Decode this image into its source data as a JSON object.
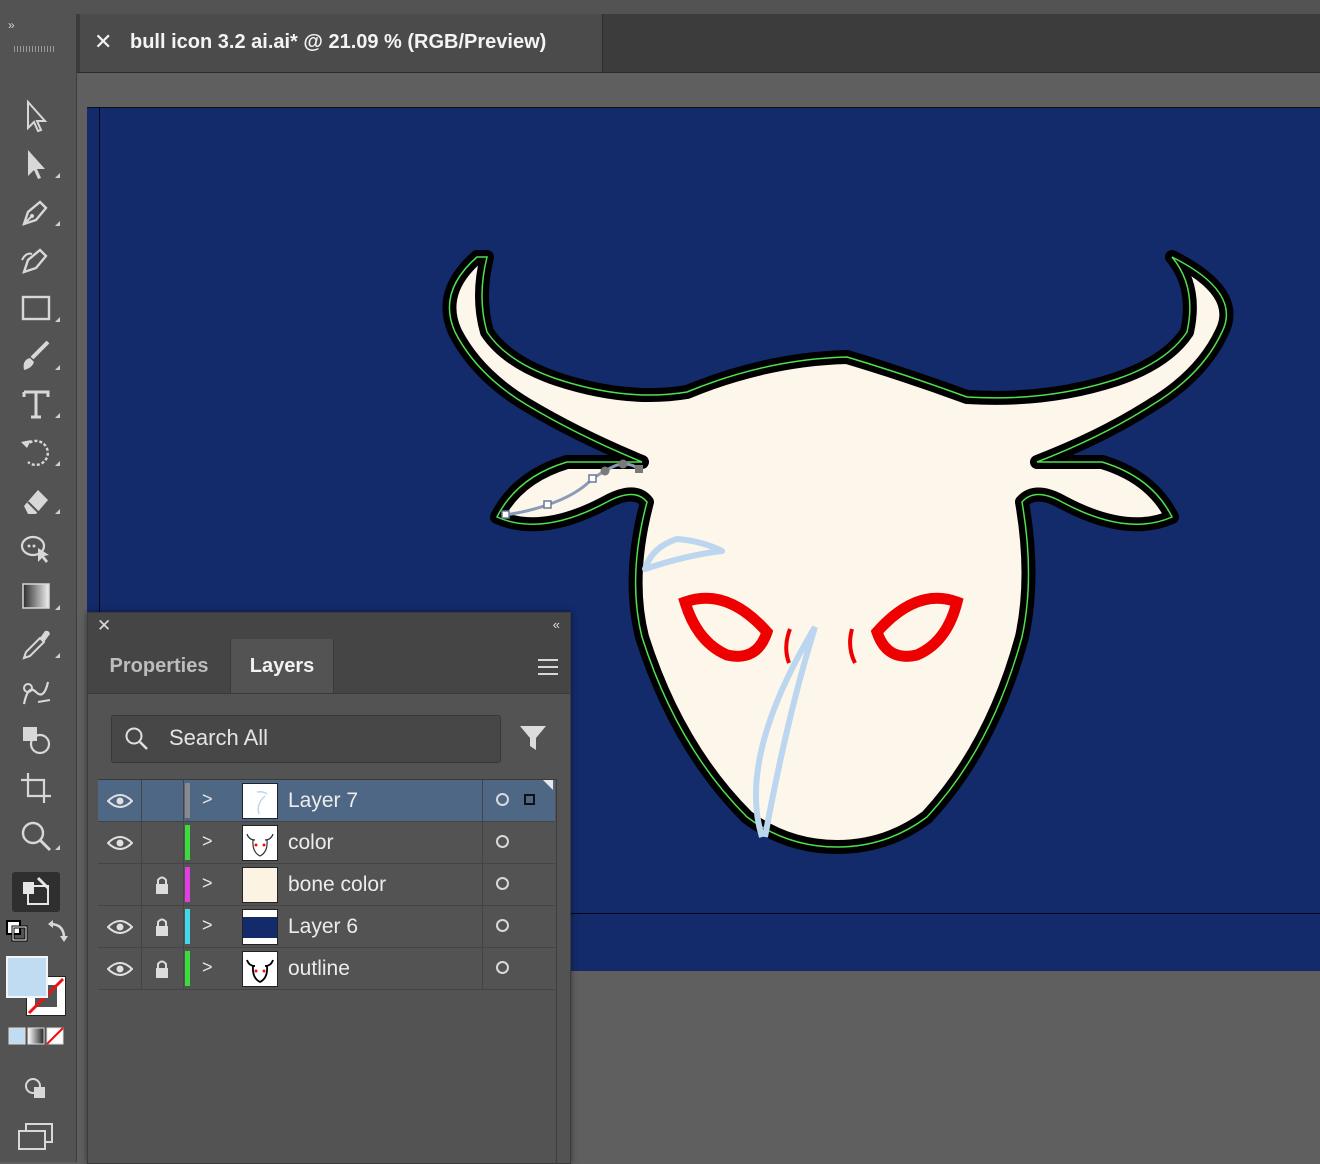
{
  "document": {
    "tab_title": "bull icon 3.2 ai.ai* @ 21.09 % (RGB/Preview)",
    "close_glyph": "✕"
  },
  "toolbar": {
    "collapse_glyph": "»",
    "tools": [
      {
        "name": "selection-tool-icon"
      },
      {
        "name": "direct-selection-tool-icon"
      },
      {
        "name": "pen-tool-icon"
      },
      {
        "name": "curvature-tool-icon"
      },
      {
        "name": "rectangle-tool-icon"
      },
      {
        "name": "paintbrush-tool-icon"
      },
      {
        "name": "type-tool-icon"
      },
      {
        "name": "rotate-tool-icon"
      },
      {
        "name": "eraser-tool-icon"
      },
      {
        "name": "puppet-warp-tool-icon"
      },
      {
        "name": "gradient-tool-icon"
      },
      {
        "name": "eyedropper-tool-icon"
      },
      {
        "name": "blend-tool-icon"
      },
      {
        "name": "shape-builder-tool-icon"
      },
      {
        "name": "artboard-tool-icon"
      },
      {
        "name": "zoom-tool-icon"
      },
      {
        "name": "edit-toolbar-icon"
      }
    ],
    "fill_color": "#bfdcf2"
  },
  "panel": {
    "close_glyph": "✕",
    "collapse_glyph": "«",
    "tabs": [
      "Properties",
      "Layers"
    ],
    "active_tab": "Layers",
    "search_placeholder": "Search All",
    "layers": [
      {
        "name": "Layer 7",
        "visible": true,
        "locked": false,
        "color": "#8a8a8a",
        "selected": true
      },
      {
        "name": "color",
        "visible": true,
        "locked": false,
        "color": "#3ddc3d",
        "selected": false
      },
      {
        "name": "bone color",
        "visible": false,
        "locked": true,
        "color": "#e040e0",
        "selected": false
      },
      {
        "name": "Layer 6",
        "visible": true,
        "locked": true,
        "color": "#40d8ea",
        "selected": false
      },
      {
        "name": "outline",
        "visible": true,
        "locked": true,
        "color": "#3ddc3d",
        "selected": false
      }
    ]
  },
  "colors": {
    "artboard": "#132a6b",
    "bone": "#fdf6ea",
    "eye_red": "#ee0000",
    "stroke_blue": "#bcd6ef"
  }
}
